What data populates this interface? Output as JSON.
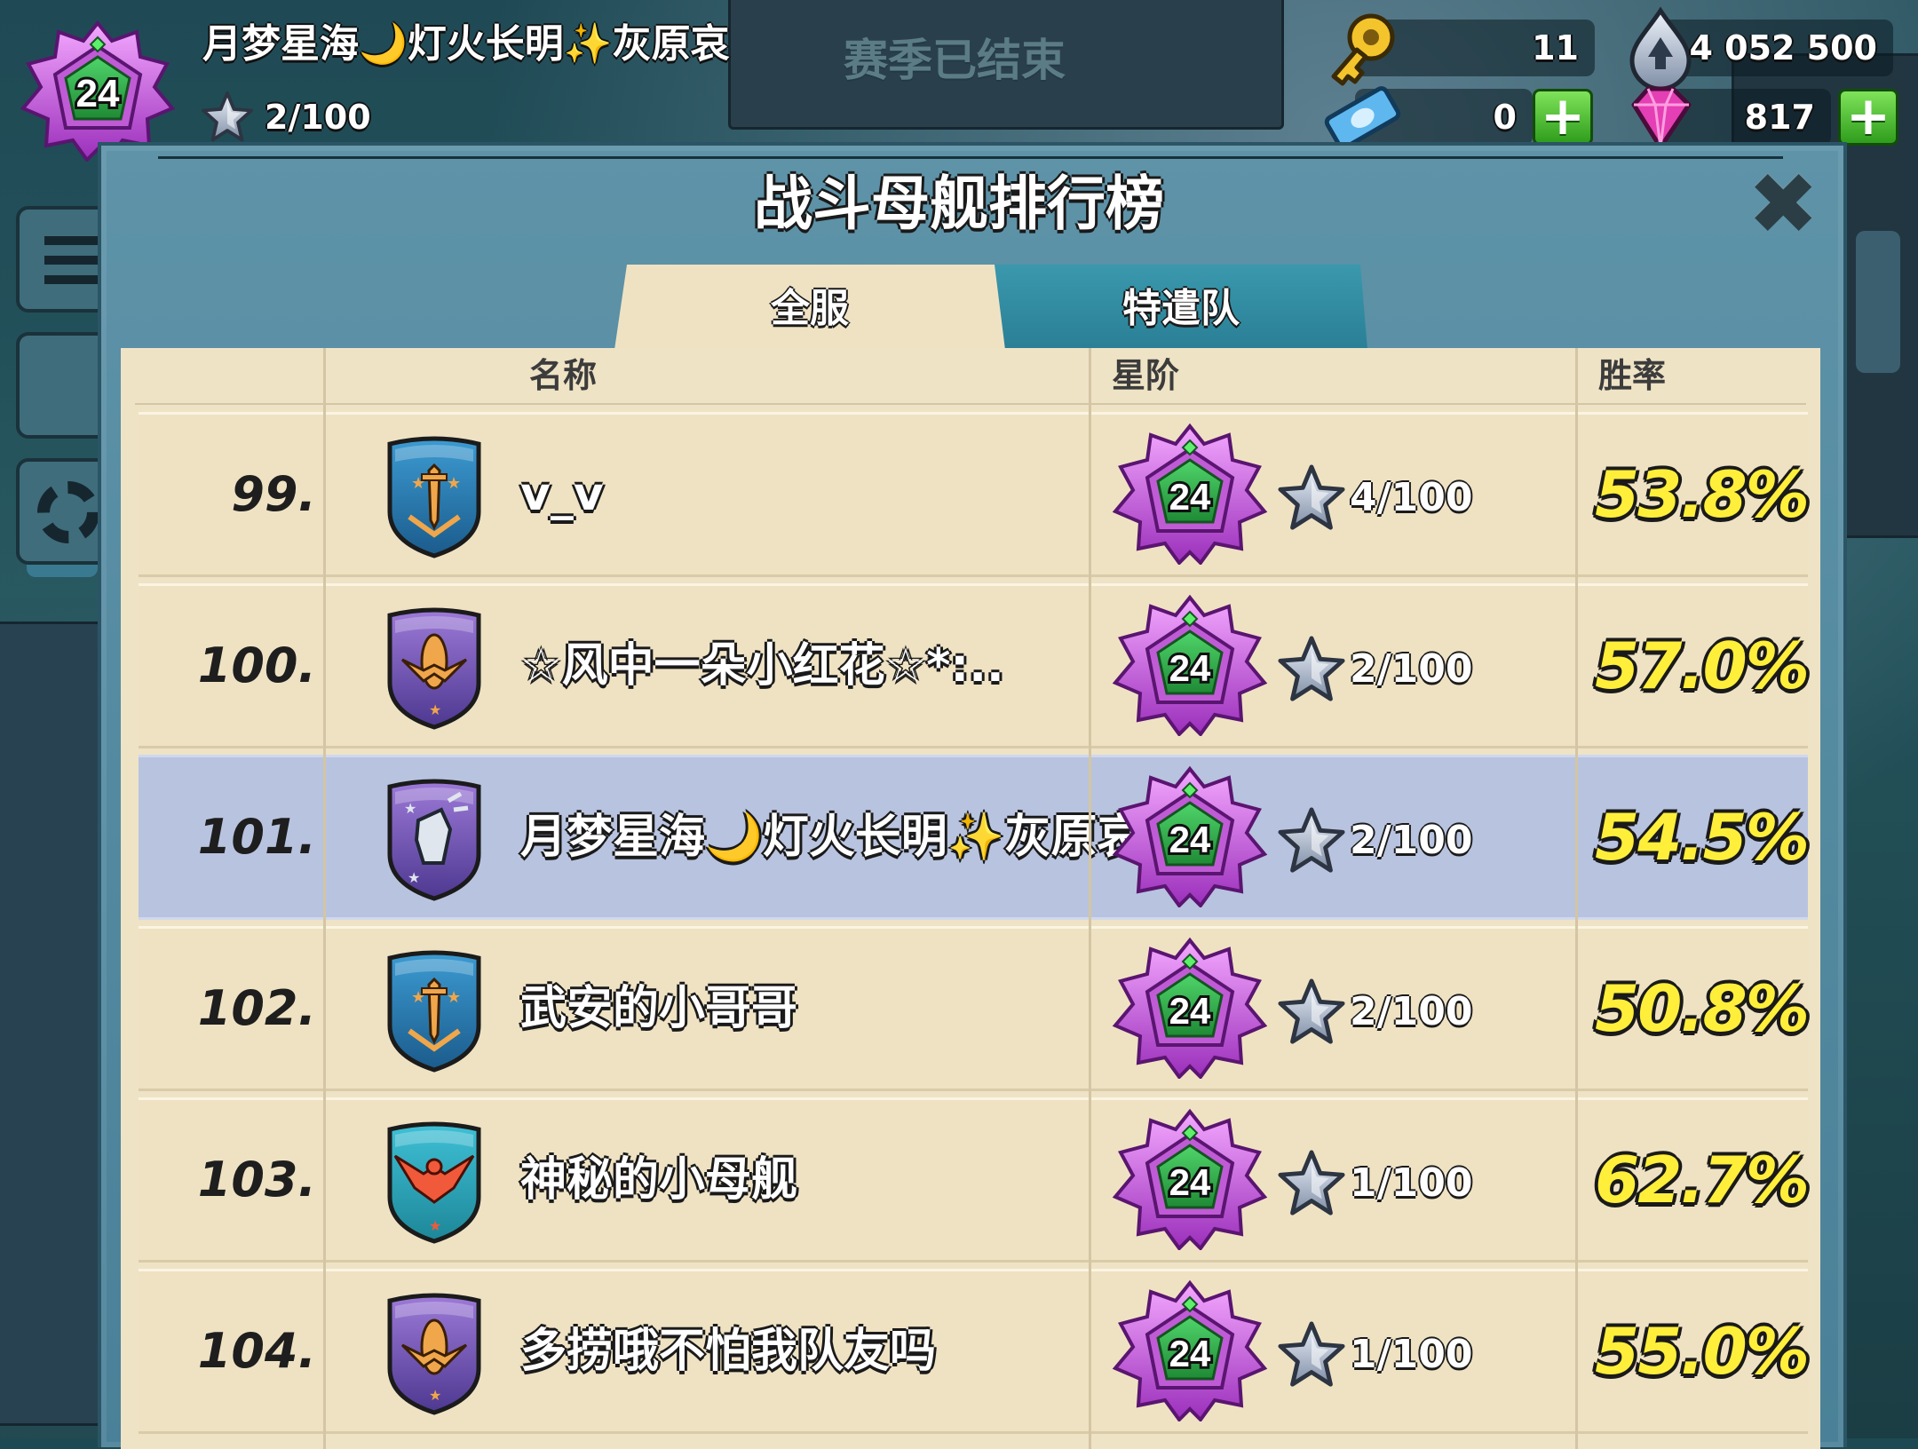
{
  "player": {
    "name": "月梦星海🌙灯火长明✨灰原哀",
    "level": "24",
    "star_progress": "2/100"
  },
  "season_status": "赛季已结束",
  "resources": {
    "keys": "11",
    "intel": "4 052 500",
    "tickets": "0",
    "gems": "817"
  },
  "panel": {
    "title": "战斗母舰排行榜",
    "close_icon": "close-icon"
  },
  "tabs": [
    {
      "label": "全服",
      "active": true
    },
    {
      "label": "特遣队",
      "active": false
    }
  ],
  "table": {
    "headers": {
      "name": "名称",
      "rank": "星阶",
      "winrate": "胜率"
    },
    "rows": [
      {
        "rank": "99.",
        "emblem": "blue-sword-shield",
        "name": "v_v",
        "level": "24",
        "stars": "4/100",
        "winrate": "53.8%",
        "highlight": false
      },
      {
        "rank": "100.",
        "emblem": "purple-rocket-shield",
        "name": "☆风中一朵小红花☆*:..",
        "level": "24",
        "stars": "2/100",
        "winrate": "57.0%",
        "highlight": false
      },
      {
        "rank": "101.",
        "emblem": "purple-fist-shield",
        "name": "月梦星海🌙灯火长明✨灰原哀",
        "level": "24",
        "stars": "2/100",
        "winrate": "54.5%",
        "highlight": true
      },
      {
        "rank": "102.",
        "emblem": "blue-sword-shield",
        "name": "武安的小哥哥",
        "level": "24",
        "stars": "2/100",
        "winrate": "50.8%",
        "highlight": false
      },
      {
        "rank": "103.",
        "emblem": "teal-eagle-shield",
        "name": "神秘的小母舰",
        "level": "24",
        "stars": "1/100",
        "winrate": "62.7%",
        "highlight": false
      },
      {
        "rank": "104.",
        "emblem": "purple-rocket-shield",
        "name": "多捞哦不怕我队友吗",
        "level": "24",
        "stars": "1/100",
        "winrate": "55.0%",
        "highlight": false
      }
    ]
  },
  "colors": {
    "panel": "#5e93a8",
    "parchment": "#efe2c3",
    "highlight_row": "#b8c3df",
    "winrate": "#ffef3a"
  }
}
